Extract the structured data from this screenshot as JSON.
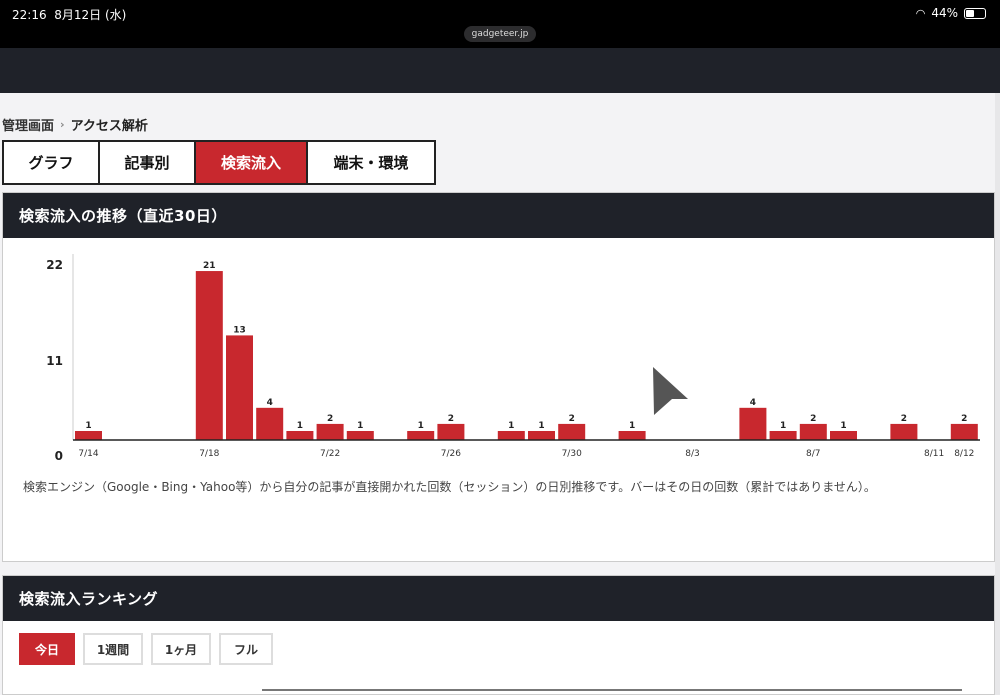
{
  "status": {
    "time": "22:16",
    "date": "8月12日 (水)",
    "battery": "44%",
    "url": "gadgeteer.jp"
  },
  "breadcrumb": {
    "home": "管理画面",
    "current": "アクセス解析"
  },
  "tabs": [
    {
      "label": "グラフ",
      "active": false
    },
    {
      "label": "記事別",
      "active": false
    },
    {
      "label": "検索流入",
      "active": true
    },
    {
      "label": "端末・環境",
      "active": false
    }
  ],
  "trend": {
    "title": "検索流入の推移（直近30日）",
    "description": "検索エンジン（Google・Bing・Yahoo等）から自分の記事が直接開かれた回数（セッション）の日別推移です。バーはその日の回数（累計ではありません）。"
  },
  "chart_data": {
    "type": "bar",
    "title": "",
    "xlabel": "",
    "ylabel": "",
    "categories": [
      "7/14",
      "7/15",
      "7/16",
      "7/17",
      "7/18",
      "7/19",
      "7/20",
      "7/21",
      "7/22",
      "7/23",
      "7/24",
      "7/25",
      "7/26",
      "7/27",
      "7/28",
      "7/29",
      "7/30",
      "7/31",
      "8/1",
      "8/2",
      "8/3",
      "8/4",
      "8/5",
      "8/6",
      "8/7",
      "8/8",
      "8/9",
      "8/10",
      "8/11",
      "8/12"
    ],
    "values": [
      1,
      0,
      0,
      0,
      21,
      13,
      4,
      1,
      2,
      1,
      0,
      1,
      2,
      0,
      1,
      1,
      2,
      0,
      1,
      0,
      0,
      0,
      4,
      1,
      2,
      1,
      0,
      2,
      0,
      2
    ],
    "x_tick_labels": [
      "7/14",
      "7/18",
      "7/22",
      "7/26",
      "7/30",
      "8/3",
      "8/7",
      "8/11",
      "8/12"
    ],
    "y_tick_labels": [
      "22",
      "11",
      "0"
    ],
    "color": "#c8282e"
  },
  "ranking": {
    "title": "検索流入ランキング",
    "periods": [
      {
        "label": "今日",
        "active": true
      },
      {
        "label": "1週間",
        "active": false
      },
      {
        "label": "1ヶ月",
        "active": false
      },
      {
        "label": "フル",
        "active": false
      }
    ]
  }
}
